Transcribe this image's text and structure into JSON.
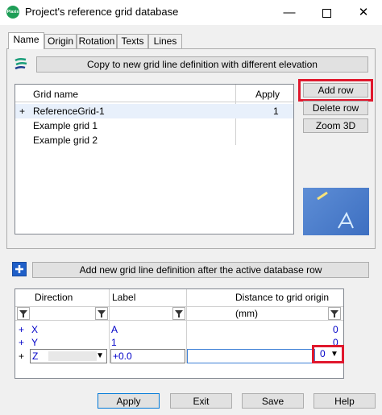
{
  "window": {
    "title": "Project's reference grid database",
    "app_icon_text": "Plaxis",
    "minimize": "—",
    "close": "✕"
  },
  "tabs": [
    {
      "label": "Name",
      "active": true
    },
    {
      "label": "Origin"
    },
    {
      "label": "Rotation"
    },
    {
      "label": "Texts"
    },
    {
      "label": "Lines"
    }
  ],
  "toolbar": {
    "copy_label": "Copy to new grid line definition with different elevation",
    "copy_icon": "copy-grid-icon"
  },
  "grid_table": {
    "columns": [
      "Grid name",
      "Apply"
    ],
    "rows": [
      {
        "marker": "+",
        "name": "ReferenceGrid-1",
        "apply": "1"
      },
      {
        "marker": "",
        "name": "Example grid 1",
        "apply": ""
      },
      {
        "marker": "",
        "name": "Example grid 2",
        "apply": ""
      }
    ]
  },
  "side_buttons": {
    "add_row": "Add row",
    "delete_row": "Delete row",
    "zoom_3d": "Zoom 3D"
  },
  "preview_icon": "3d-preview-icon",
  "add_line": {
    "icon": "plus-icon",
    "label": "Add new grid line definition after the active database row"
  },
  "lines_table": {
    "columns": [
      "Direction",
      "Label",
      "Distance to grid origin (mm)"
    ],
    "rows": [
      {
        "marker": "+",
        "direction": "X",
        "label": "A",
        "distance": "0"
      },
      {
        "marker": "+",
        "direction": "Y",
        "label": "1",
        "distance": "0"
      },
      {
        "marker": "+",
        "direction": "Z",
        "label": "+0.0",
        "distance": "0"
      }
    ]
  },
  "bottom_buttons": {
    "apply": "Apply",
    "exit": "Exit",
    "save": "Save",
    "help": "Help"
  },
  "colors": {
    "highlight": "#e0182d",
    "value_blue": "#0000c8",
    "selection": "#e8f0fb"
  }
}
